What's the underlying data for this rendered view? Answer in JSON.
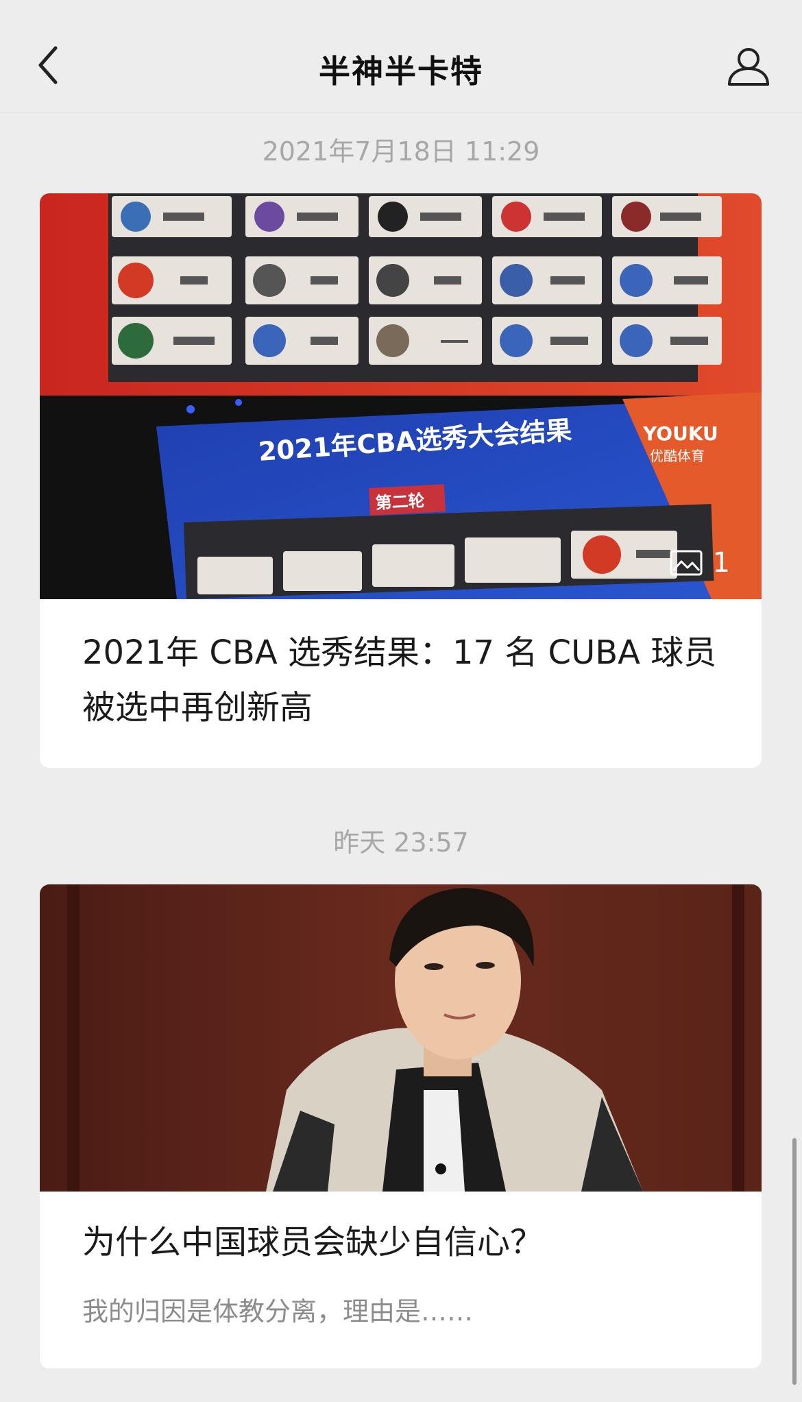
{
  "header": {
    "title": "半神半卡特",
    "back_icon": "chevron-left-icon",
    "profile_icon": "user-icon"
  },
  "messages": [
    {
      "timestamp": "2021年7月18日 11:29",
      "title": "2021年 CBA 选秀结果：17 名 CUBA 球员被选中再创新高",
      "image_count": "1",
      "image_overlay": {
        "board_title": "2021年CBA选秀大会结果",
        "round_label": "第二轮",
        "brand": "YOUKU",
        "brand_sub": "优酷体育"
      }
    },
    {
      "timestamp": "昨天 23:57",
      "title": "为什么中国球员会缺少自信心？",
      "description": "我的归因是体教分离，理由是……"
    }
  ],
  "colors": {
    "background": "#ededed",
    "card": "#ffffff",
    "timestamp": "#a7a7a7"
  }
}
